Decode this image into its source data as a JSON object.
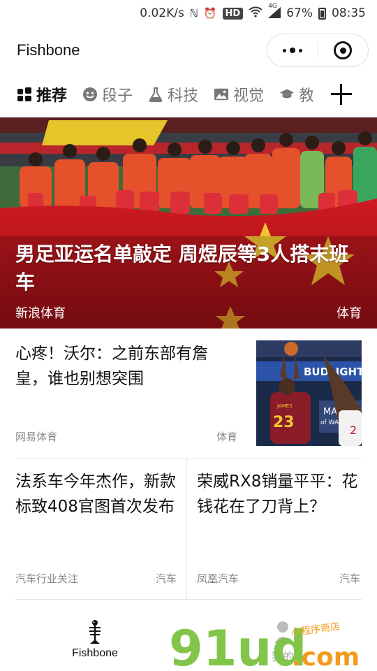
{
  "status_bar": {
    "speed": "0.02K/s",
    "hd": "HD",
    "network": "4G",
    "battery": "67%",
    "time": "08:35"
  },
  "title_bar": {
    "title": "Fishbone"
  },
  "tabs": [
    {
      "label": "推荐",
      "icon": "grid-icon",
      "active": true
    },
    {
      "label": "段子",
      "icon": "smiley-icon",
      "active": false
    },
    {
      "label": "科技",
      "icon": "flask-icon",
      "active": false
    },
    {
      "label": "视觉",
      "icon": "image-icon",
      "active": false
    },
    {
      "label": "教",
      "icon": "graduation-cap-icon",
      "active": false
    }
  ],
  "hero": {
    "title": "男足亚运名单敲定 周煜辰等3人搭末班车",
    "source": "新浪体育",
    "tag": "体育"
  },
  "article1": {
    "title": "心疼！沃尔：之前东部有詹皇，谁也别想突围",
    "source": "网易体育",
    "tag": "体育",
    "thumb_text": {
      "banner": "BUDLIGHT",
      "jersey_top": "JAMES",
      "jersey_number": "23",
      "side_text": "MAS\nof WAS"
    }
  },
  "article2": {
    "title": "法系车今年杰作，新款标致408官图首次发布",
    "source": "汽车行业关注",
    "tag": "汽车"
  },
  "article3": {
    "title": "荣威RX8销量平平：花钱花在了刀背上？",
    "source": "凤凰汽车",
    "tag": "汽车"
  },
  "bottom_nav": {
    "home_label": "Fishbone",
    "mine_label": "我的"
  },
  "watermark": {
    "logo": "91ud",
    "suffix": ".com",
    "tagline": "小程序商店"
  },
  "colors": {
    "accent_green": "#7dc242",
    "accent_orange": "#f49b1c",
    "hero_red": "#c8102e"
  }
}
